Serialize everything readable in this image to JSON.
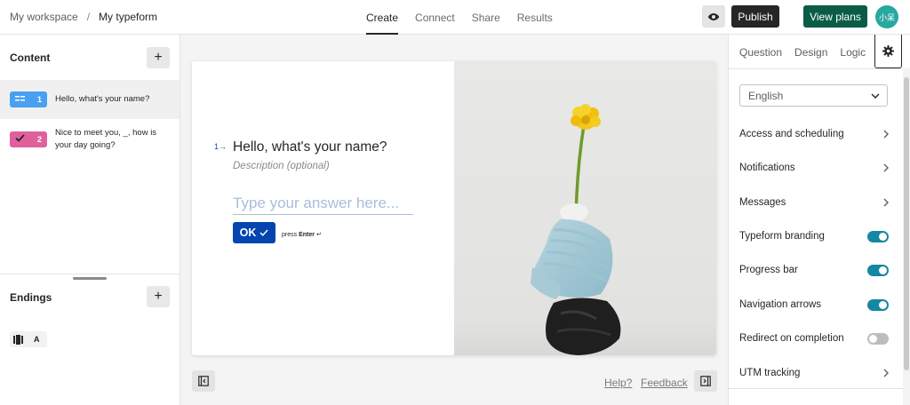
{
  "breadcrumb": {
    "workspace": "My workspace",
    "separator": "/",
    "form": "My typeform"
  },
  "nav_tabs": [
    {
      "label": "Create",
      "active": true
    },
    {
      "label": "Connect",
      "active": false
    },
    {
      "label": "Share",
      "active": false
    },
    {
      "label": "Results",
      "active": false
    }
  ],
  "header": {
    "publish_label": "Publish",
    "view_plans_label": "View plans",
    "avatar_text": "小呆"
  },
  "colors": {
    "view_plans": "#0a5c46",
    "ok_button": "#0445af",
    "toggle_on": "#1587a2",
    "badge_blue": "#4aa0f0",
    "badge_pink": "#e0609e"
  },
  "sidebar": {
    "content_title": "Content",
    "questions": [
      {
        "number": "1",
        "text": "Hello, what's your name?",
        "icon": "short-text-icon",
        "color": "blue",
        "selected": true
      },
      {
        "number": "2",
        "text": "Nice to meet you, _, how is your day going?",
        "icon": "checkmark-icon",
        "color": "pink",
        "selected": false
      }
    ],
    "endings_title": "Endings",
    "ending": {
      "label": "A",
      "icon": "ending-screen-icon"
    }
  },
  "preview": {
    "question_number": "1",
    "question_arrow": "→",
    "question_title": "Hello, what's your name?",
    "description_placeholder": "Description (optional)",
    "answer_placeholder": "Type your answer here...",
    "ok_label": "OK",
    "press_label": "press",
    "enter_label": "Enter",
    "enter_glyph": "↵"
  },
  "footer": {
    "help_label": "Help?",
    "feedback_label": "Feedback"
  },
  "right_panel": {
    "tabs": [
      "Question",
      "Design",
      "Logic"
    ],
    "language": "English",
    "settings": [
      {
        "label": "Access and scheduling",
        "kind": "chevron"
      },
      {
        "label": "Notifications",
        "kind": "chevron"
      },
      {
        "label": "Messages",
        "kind": "chevron"
      },
      {
        "label": "Typeform branding",
        "kind": "toggle",
        "on": true
      },
      {
        "label": "Progress bar",
        "kind": "toggle",
        "on": true
      },
      {
        "label": "Navigation arrows",
        "kind": "toggle",
        "on": true
      },
      {
        "label": "Redirect on completion",
        "kind": "toggle",
        "on": false
      },
      {
        "label": "UTM tracking",
        "kind": "chevron"
      }
    ]
  }
}
